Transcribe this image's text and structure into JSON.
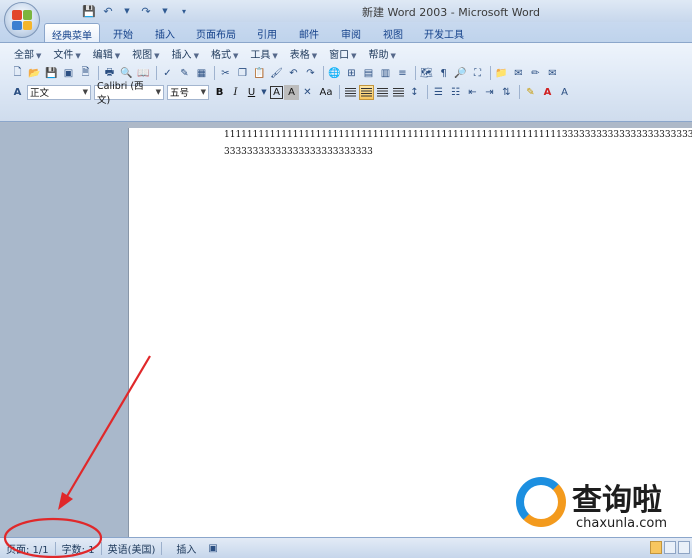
{
  "window": {
    "title": "新建 Word 2003 - Microsoft Word"
  },
  "ribbon_tabs": [
    {
      "label": "经典菜单",
      "active": true
    },
    {
      "label": "开始",
      "active": false
    },
    {
      "label": "插入",
      "active": false
    },
    {
      "label": "页面布局",
      "active": false
    },
    {
      "label": "引用",
      "active": false
    },
    {
      "label": "邮件",
      "active": false
    },
    {
      "label": "审阅",
      "active": false
    },
    {
      "label": "视图",
      "active": false
    },
    {
      "label": "开发工具",
      "active": false
    }
  ],
  "menu": [
    {
      "label": "全部"
    },
    {
      "label": "文件"
    },
    {
      "label": "编辑"
    },
    {
      "label": "视图"
    },
    {
      "label": "插入"
    },
    {
      "label": "格式"
    },
    {
      "label": "工具"
    },
    {
      "label": "表格"
    },
    {
      "label": "窗口"
    },
    {
      "label": "帮助"
    }
  ],
  "format_bar": {
    "style_value": "正文",
    "font_value": "Calibri (西文)",
    "size_value": "五号",
    "bold": "B",
    "italic": "I",
    "underline": "U",
    "box_char": "A",
    "shade_char": "A",
    "case_char": "Aa",
    "style_glyph": "A"
  },
  "document": {
    "lines": [
      "11111111111111111111111111111111111111111111111111111111111333333333333333333333333",
      "33333333333333333333333333"
    ]
  },
  "status_bar": {
    "page": "页面: 1/1",
    "word_count": "字数: 1",
    "language": "英语(美国)",
    "mode": "插入"
  },
  "watermark": {
    "title": "查询啦",
    "url": "chaxunla.com"
  },
  "colors": {
    "annotation_red": "#e0282a",
    "office_red": "#e2472c",
    "office_green": "#7bb53e",
    "office_blue": "#3c7fd1",
    "office_yellow": "#f5b52a",
    "watermark_blue": "#1c8fe0",
    "watermark_orange": "#f39a1d"
  }
}
